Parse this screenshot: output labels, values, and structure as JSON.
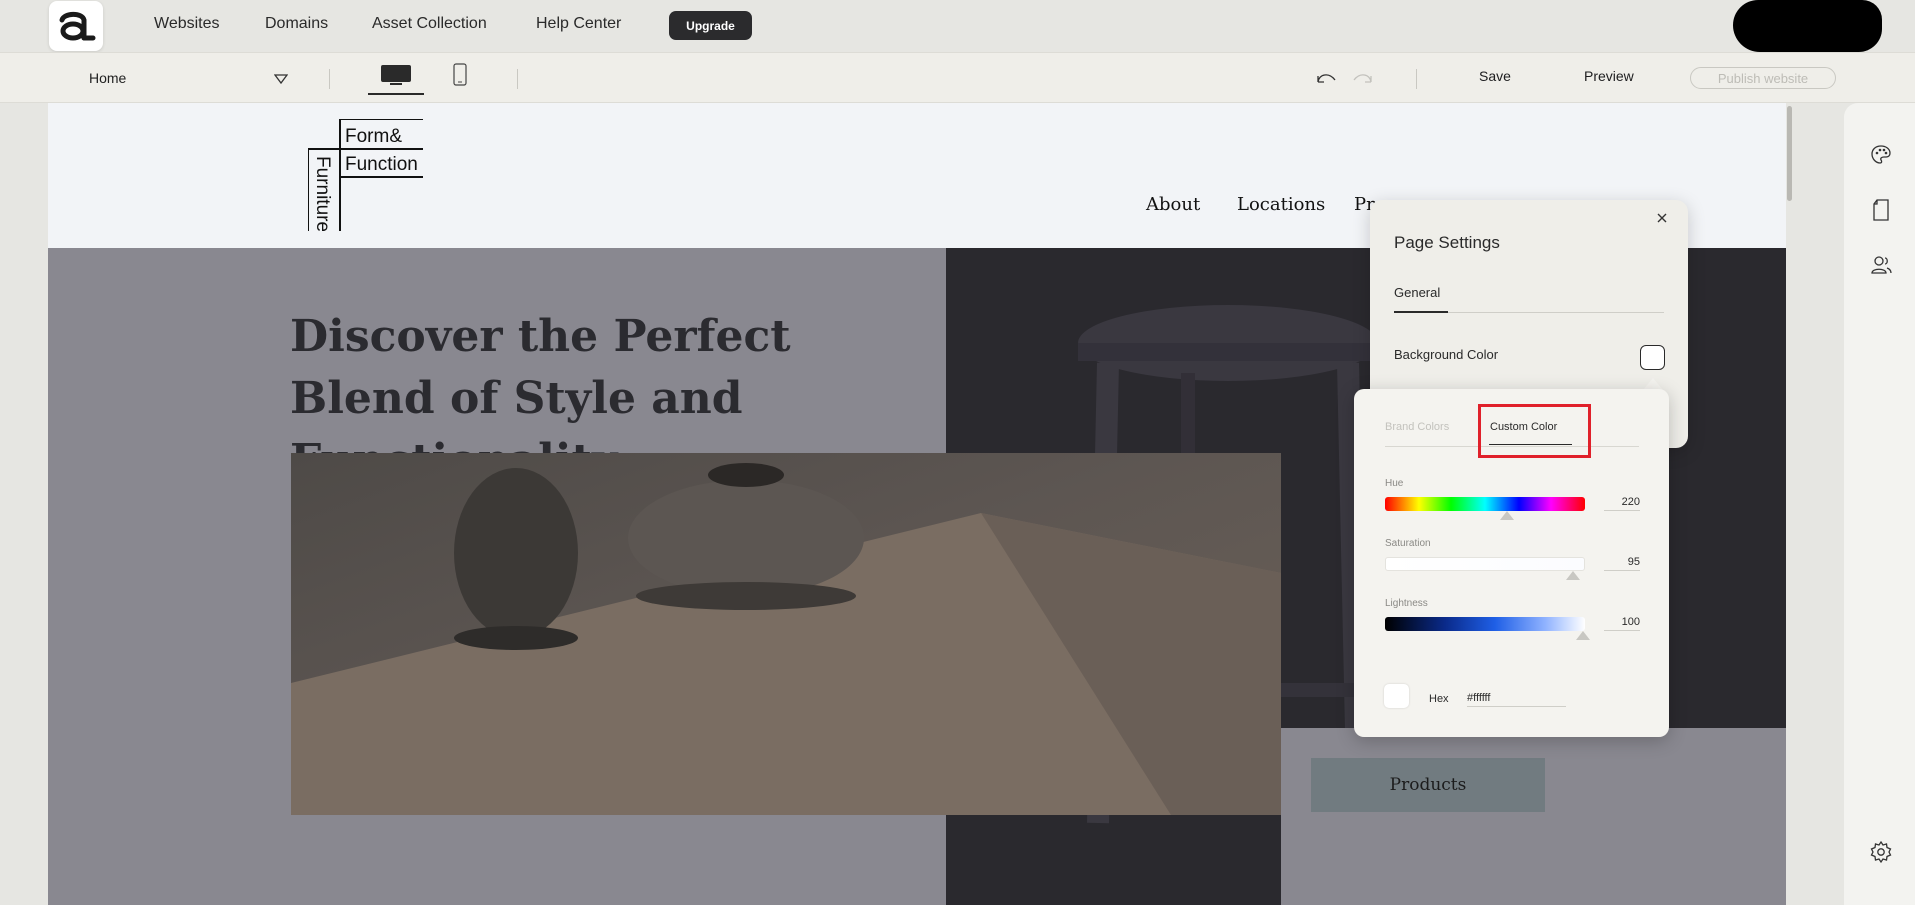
{
  "topbar": {
    "nav": [
      "Websites",
      "Domains",
      "Asset Collection",
      "Help Center"
    ],
    "upgrade_label": "Upgrade"
  },
  "toolbar": {
    "page_select": "Home",
    "save_label": "Save",
    "preview_label": "Preview",
    "publish_label": "Publish website"
  },
  "site": {
    "logo": {
      "top": "Form&",
      "middle": "Function",
      "vertical": "Furniture"
    },
    "nav": [
      "About",
      "Locations",
      "Pr"
    ],
    "hero_title": "Discover the Perfect Blend of Style and Functionality",
    "products_button": "Products"
  },
  "page_settings": {
    "title": "Page Settings",
    "tab": "General",
    "background_label": "Background Color",
    "background_value": "#ffffff"
  },
  "color_picker": {
    "tabs": [
      "Brand Colors",
      "Custom Color"
    ],
    "active_tab": "Custom Color",
    "hue": {
      "label": "Hue",
      "value": "220"
    },
    "saturation": {
      "label": "Saturation",
      "value": "95"
    },
    "lightness": {
      "label": "Lightness",
      "value": "100"
    },
    "hex": {
      "label": "Hex",
      "value": "#ffffff"
    }
  },
  "colors": {
    "accent_dark": "#2b2b2d",
    "highlight_red": "#e0202a",
    "canvas_overlay": "#898890"
  },
  "icons": [
    "app-logo-icon",
    "chevron-down-icon",
    "desktop-icon",
    "mobile-icon",
    "undo-icon",
    "redo-icon",
    "palette-icon",
    "page-icon",
    "users-icon",
    "settings-icon",
    "close-icon"
  ]
}
